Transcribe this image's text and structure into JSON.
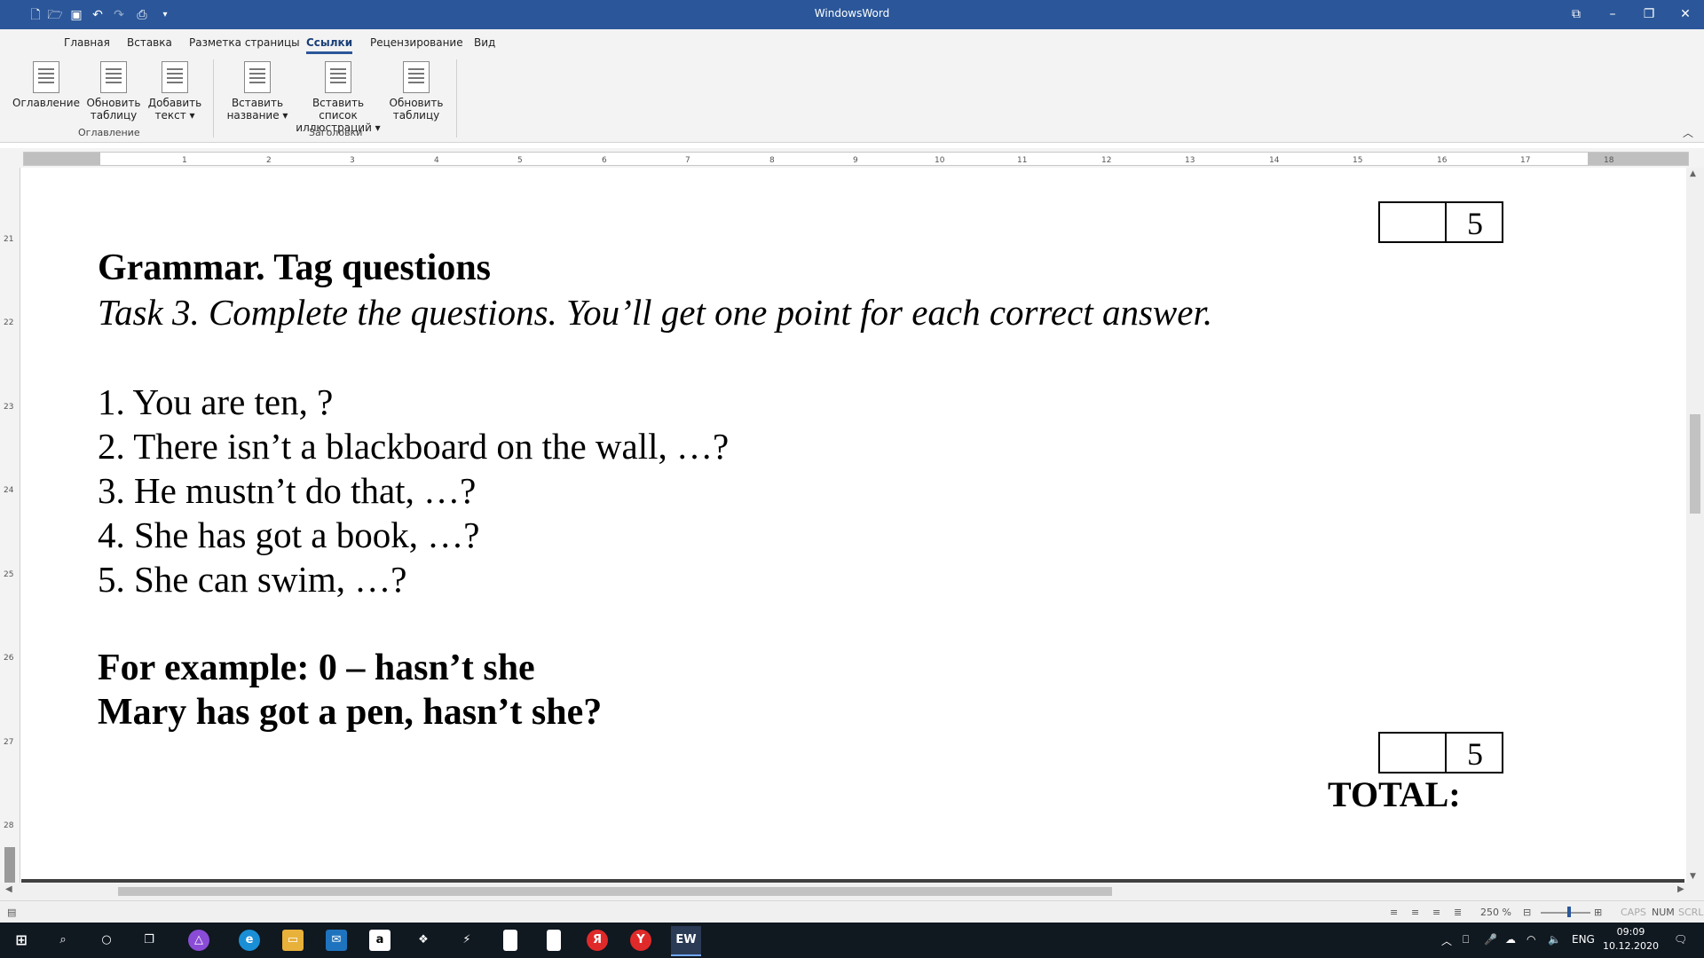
{
  "window": {
    "title": "WindowsWord"
  },
  "quick_access": {
    "new_icon": "new-document-icon",
    "open_icon": "open-folder-icon",
    "save_icon": "save-icon",
    "undo_icon": "undo-icon",
    "redo_icon": "redo-icon",
    "preview_icon": "print-preview-icon",
    "customize_icon": "customize-arrow-icon"
  },
  "window_controls": [
    "ribbon-display-icon",
    "minimize-icon",
    "restore-icon",
    "close-icon"
  ],
  "tabs": [
    {
      "label": "Главная"
    },
    {
      "label": "Вставка"
    },
    {
      "label": "Разметка страницы"
    },
    {
      "label": "Ссылки",
      "active": true
    },
    {
      "label": "Рецензирование"
    },
    {
      "label": "Вид"
    }
  ],
  "ribbon": {
    "groups": [
      {
        "label": "Оглавление",
        "buttons": [
          {
            "line1": "Оглавление",
            "line2": ""
          },
          {
            "line1": "Обновить",
            "line2": "таблицу"
          },
          {
            "line1": "Добавить",
            "line2": "текст ▾"
          }
        ]
      },
      {
        "label": "Заголовки",
        "buttons": [
          {
            "line1": "Вставить",
            "line2": "название ▾"
          },
          {
            "line1": "Вставить список",
            "line2": "иллюстраций ▾"
          },
          {
            "line1": "Обновить",
            "line2": "таблицу"
          }
        ]
      }
    ]
  },
  "ruler": {
    "h_ticks": [
      "1",
      "2",
      "3",
      "4",
      "5",
      "6",
      "7",
      "8",
      "9",
      "10",
      "11",
      "12",
      "13",
      "14",
      "15",
      "16",
      "17",
      "18"
    ],
    "v_ticks": [
      "21",
      "22",
      "23",
      "24",
      "25",
      "26",
      "27",
      "28"
    ]
  },
  "document": {
    "score_box_1": "5",
    "heading": "Grammar. Tag questions",
    "task": "Task 3. Complete the questions. You’ll get one point for each correct answer.",
    "items": [
      "1. You are ten, ?",
      "2. There isn’t a blackboard on the wall, …?",
      "3. He mustn’t do that, …?",
      "4. She has got a book, …?",
      "5. She can swim, …?"
    ],
    "example_1": "For example: 0 – hasn’t she",
    "example_2": "Mary has got a pen, hasn’t she?",
    "score_box_2": "5",
    "total": "TOTAL:"
  },
  "statusbar": {
    "zoom": "250 %",
    "caps": "CAPS",
    "num": "NUM",
    "scrl": "SCRL"
  },
  "taskbar": {
    "apps": [
      "windows-start-icon",
      "search-icon",
      "cortana-icon",
      "task-view-icon",
      "app-purple-icon",
      "edge-icon",
      "file-explorer-icon",
      "mail-icon",
      "amazon-icon",
      "dropbox-icon",
      "app-arrow-icon",
      "document-icon",
      "document-icon",
      "yandex-icon",
      "yandex-browser-icon",
      "windowsword-icon"
    ],
    "lang": "ENG",
    "time": "09:09",
    "date": "10.12.2020"
  }
}
